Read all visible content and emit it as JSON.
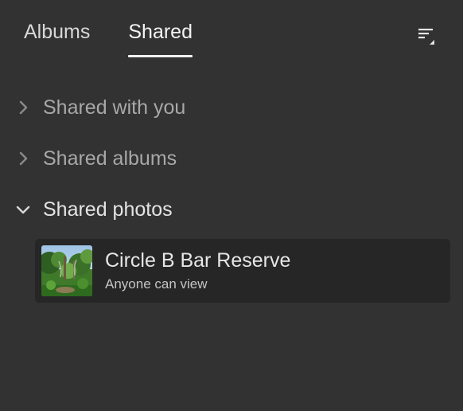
{
  "tabs": [
    {
      "label": "Albums",
      "active": false
    },
    {
      "label": "Shared",
      "active": true
    }
  ],
  "sort": {
    "icon": "sort-icon"
  },
  "sections": [
    {
      "label": "Shared with you",
      "expanded": false
    },
    {
      "label": "Shared albums",
      "expanded": false
    },
    {
      "label": "Shared photos",
      "expanded": true
    }
  ],
  "shared_photos": [
    {
      "title": "Circle B Bar Reserve",
      "subtitle": "Anyone can view",
      "thumbnail_icon": "nature-photo-thumbnail"
    }
  ],
  "colors": {
    "background": "#323232",
    "card": "#262626",
    "active_tab_underline": "#f0f0f0"
  }
}
